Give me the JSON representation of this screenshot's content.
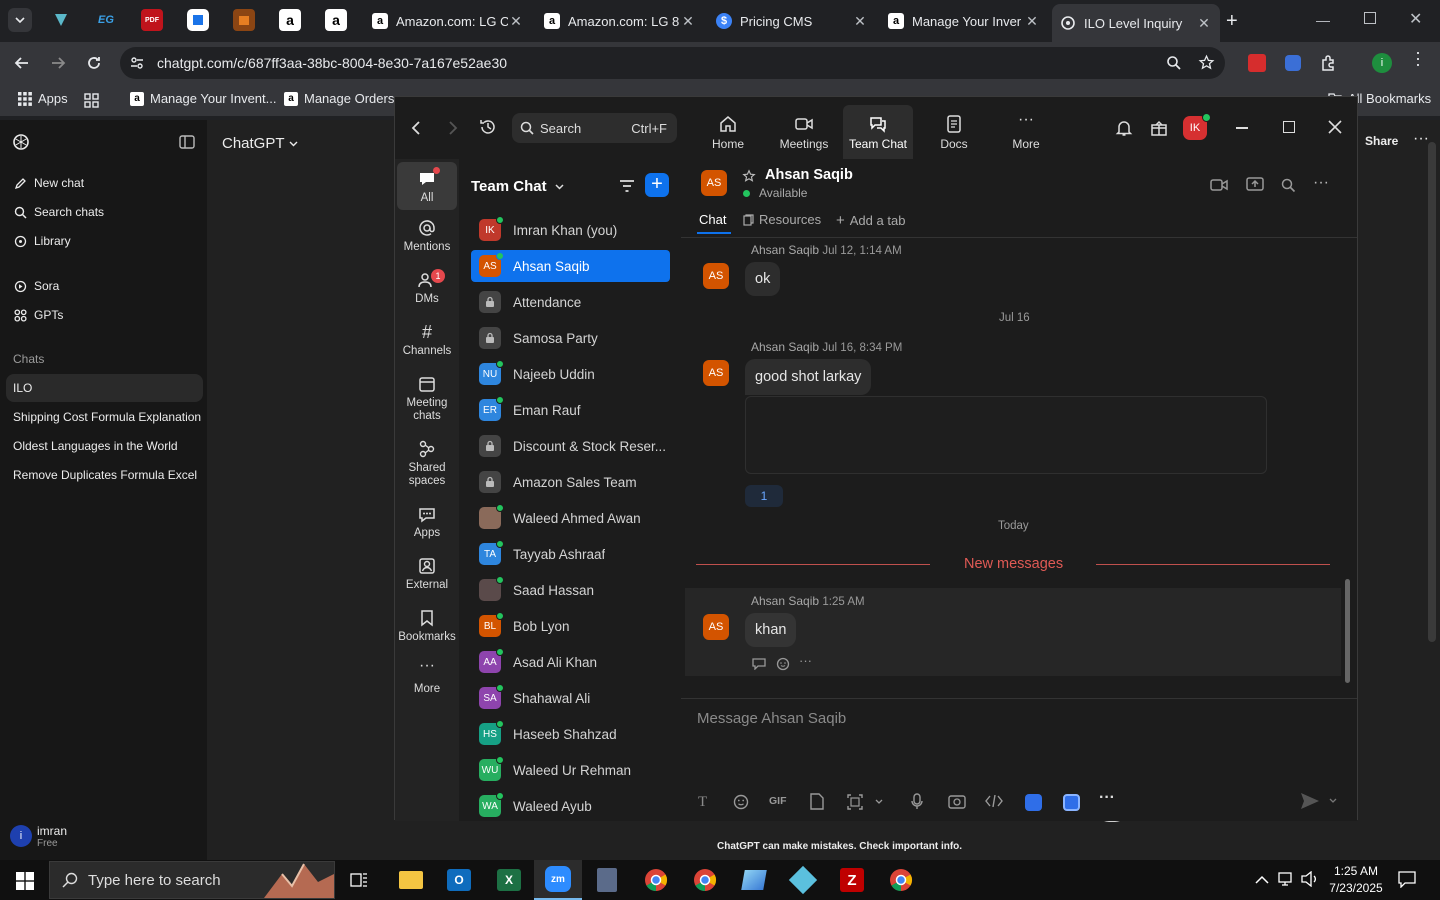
{
  "browser": {
    "tabs": [
      {
        "label": "Amazon.com: LG C"
      },
      {
        "label": "Amazon.com: LG 8"
      },
      {
        "label": "Pricing CMS"
      },
      {
        "label": "Manage Your Inver"
      },
      {
        "label": "ILO Level Inquiry"
      }
    ],
    "pinned_icons": [
      "EG",
      "PDF"
    ],
    "url": "chatgpt.com/c/687ff3aa-38bc-8004-8e30-7a167e52ae30",
    "profile_initial": "i",
    "bookmarks": [
      {
        "label": "Apps"
      },
      {
        "label": "Manage Your Invent..."
      },
      {
        "label": "Manage Orders"
      }
    ],
    "all_bookmarks": "All Bookmarks"
  },
  "chatgpt": {
    "title": "ChatGPT",
    "new_chat": "New chat",
    "search_chats": "Search chats",
    "library": "Library",
    "sora": "Sora",
    "gpts": "GPTs",
    "chats_heading": "Chats",
    "chats": [
      "ILO",
      "Shipping Cost Formula Explanation",
      "Oldest Languages in the World",
      "Remove Duplicates Formula Excel"
    ],
    "share": "Share",
    "user_name": "imran",
    "user_plan": "Free",
    "user_initial": "i",
    "footer": "ChatGPT can make mistakes. Check important info."
  },
  "zoom": {
    "search_label": "Search",
    "search_shortcut": "Ctrl+F",
    "nav": [
      {
        "label": "Home"
      },
      {
        "label": "Meetings"
      },
      {
        "label": "Team Chat"
      },
      {
        "label": "Docs"
      },
      {
        "label": "More"
      }
    ],
    "avatar_initials": "IK",
    "rail": [
      {
        "label": "All"
      },
      {
        "label": "Mentions"
      },
      {
        "label": "DMs",
        "badge": "1"
      },
      {
        "label": "Channels"
      },
      {
        "label": "Meeting chats"
      },
      {
        "label": "Shared spaces"
      },
      {
        "label": "Apps"
      },
      {
        "label": "External"
      },
      {
        "label": "Bookmarks"
      },
      {
        "label": "More"
      }
    ],
    "list_title": "Team Chat",
    "contacts": [
      {
        "initials": "IK",
        "name": "Imran Khan (you)",
        "color": "#c0392b"
      },
      {
        "initials": "AS",
        "name": "Ahsan Saqib",
        "color": "#d35400"
      },
      {
        "initials": "",
        "name": "Attendance",
        "color": "#444444"
      },
      {
        "initials": "",
        "name": "Samosa Party",
        "color": "#444444"
      },
      {
        "initials": "NU",
        "name": "Najeeb Uddin",
        "color": "#2e86de"
      },
      {
        "initials": "ER",
        "name": "Eman Rauf",
        "color": "#2e86de"
      },
      {
        "initials": "",
        "name": "Discount & Stock Reser...",
        "color": "#444444"
      },
      {
        "initials": "",
        "name": "Amazon Sales Team",
        "color": "#444444"
      },
      {
        "initials": "",
        "name": "Waleed Ahmed Awan",
        "color": "#8a6a5a"
      },
      {
        "initials": "TA",
        "name": "Tayyab Ashraaf",
        "color": "#2e86de"
      },
      {
        "initials": "",
        "name": "Saad Hassan",
        "color": "#5a4a4a"
      },
      {
        "initials": "BL",
        "name": "Bob Lyon",
        "color": "#d35400"
      },
      {
        "initials": "AA",
        "name": "Asad Ali Khan",
        "color": "#8e44ad"
      },
      {
        "initials": "SA",
        "name": "Shahawal Ali",
        "color": "#8e44ad"
      },
      {
        "initials": "HS",
        "name": "Haseeb Shahzad",
        "color": "#16a085"
      },
      {
        "initials": "WU",
        "name": "Waleed Ur Rehman",
        "color": "#27ae60"
      },
      {
        "initials": "WA",
        "name": "Waleed Ayub",
        "color": "#27ae60"
      }
    ],
    "chat": {
      "contact_initials": "AS",
      "contact_name": "Ahsan Saqib",
      "status": "Available",
      "tabs": [
        "Chat",
        "Resources",
        "Add a tab"
      ],
      "messages": [
        {
          "sender": "Ahsan Saqib",
          "time": "Jul 12, 1:14 AM",
          "text": "ok"
        },
        {
          "sender": "Ahsan Saqib",
          "time": "Jul 16, 8:34 PM",
          "text": "good shot larkay"
        },
        {
          "sender": "Ahsan Saqib",
          "time": "1:25 AM",
          "text": "khan"
        }
      ],
      "date_jul16": "Jul 16",
      "date_today": "Today",
      "reply_count": "1",
      "new_messages": "New messages",
      "input_placeholder": "Message Ahsan Saqib",
      "gif_label": "GIF"
    }
  },
  "taskbar": {
    "search_placeholder": "Type here to search",
    "time": "1:25 AM",
    "date": "7/23/2025"
  }
}
